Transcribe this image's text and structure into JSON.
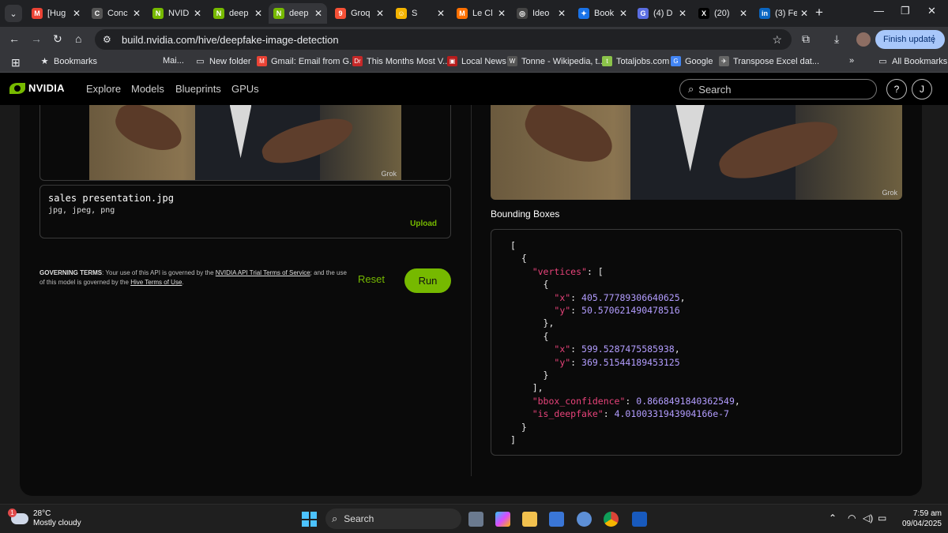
{
  "tabs": [
    {
      "title": "[Hug",
      "fav": "M",
      "color": "#ea4335"
    },
    {
      "title": "Conc",
      "fav": "C",
      "color": "#555555"
    },
    {
      "title": "NVID",
      "fav": "N",
      "color": "#76b900"
    },
    {
      "title": "deep",
      "fav": "N",
      "color": "#76b900"
    },
    {
      "title": "deep",
      "fav": "N",
      "color": "#76b900",
      "active": true
    },
    {
      "title": "Groq",
      "fav": "9",
      "color": "#f55036"
    },
    {
      "title": "S",
      "fav": "☺",
      "color": "#f4b400"
    },
    {
      "title": "Le Cl",
      "fav": "M",
      "color": "#ff7000"
    },
    {
      "title": "Ideo",
      "fav": "◎",
      "color": "#444444"
    },
    {
      "title": "Book",
      "fav": "✦",
      "color": "#1a73e8"
    },
    {
      "title": "(4) D",
      "fav": "G",
      "color": "#5b6ee1"
    },
    {
      "title": "(20)",
      "fav": "X",
      "color": "#000000"
    },
    {
      "title": "(3) Fe",
      "fav": "in",
      "color": "#0a66c2"
    }
  ],
  "toolbar": {
    "url": "build.nvidia.com/hive/deepfake-image-detection",
    "finish_update": "Finish update"
  },
  "bookmarks": [
    {
      "label": "Bookmarks",
      "icon": "★"
    },
    {
      "label": "Mai...",
      "icon": ""
    },
    {
      "label": "New folder",
      "icon": "▭"
    },
    {
      "label": "Gmail: Email from G...",
      "icon": "M"
    },
    {
      "label": "This Months Most V...",
      "icon": "Dr"
    },
    {
      "label": "Local News",
      "icon": "▣"
    },
    {
      "label": "Tonne - Wikipedia, t...",
      "icon": "W"
    },
    {
      "label": "Totaljobs.com",
      "icon": "t"
    },
    {
      "label": "Google",
      "icon": "G"
    },
    {
      "label": "Transpose Excel dat...",
      "icon": "✈"
    },
    {
      "label": "All Bookmarks",
      "icon": "▭"
    }
  ],
  "nav": {
    "brand": "NVIDIA",
    "links": [
      "Explore",
      "Models",
      "Blueprints",
      "GPUs"
    ],
    "search_placeholder": "Search",
    "help": "?",
    "user_initial": "J"
  },
  "input": {
    "file_name": "sales presentation.jpg",
    "file_types": "jpg, jpeg, png",
    "upload": "Upload",
    "watermark": "Grok"
  },
  "terms": {
    "heading": "GOVERNING TERMS",
    "text1": ": Your use of this API is governed by the ",
    "link1": "NVIDIA API Trial Terms of Service",
    "text2": "; and the use of this model is governed by the ",
    "link2": "Hive Terms of Use",
    "text3": "."
  },
  "actions": {
    "reset": "Reset",
    "run": "Run"
  },
  "output": {
    "title": "Bounding Boxes",
    "watermark": "Grok",
    "keys": {
      "vertices": "\"vertices\"",
      "x": "\"x\"",
      "y": "\"y\"",
      "bbox_confidence": "\"bbox_confidence\"",
      "is_deepfake": "\"is_deepfake\""
    },
    "v1x": "405.77789306640625",
    "v1y": "50.570621490478516",
    "v2x": "599.5287475585938",
    "v2y": "369.51544189453125",
    "bbox_confidence": "0.8668491840362549",
    "is_deepfake": "4.0100331943904166e-7"
  },
  "taskbar": {
    "temp": "28°C",
    "condition": "Mostly cloudy",
    "weather_badge": "1",
    "search": "Search",
    "time": "7:59 am",
    "date": "09/04/2025"
  }
}
